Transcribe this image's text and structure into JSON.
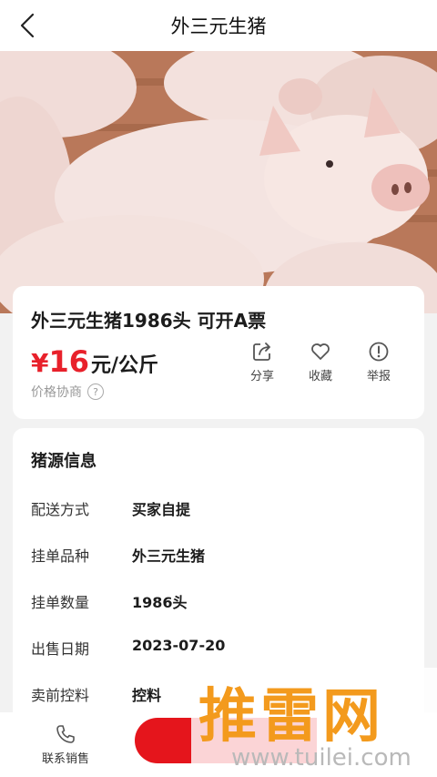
{
  "header": {
    "title": "外三元生猪",
    "back_icon": "chevron-left-icon"
  },
  "product": {
    "title": "外三元生猪1986头 可开A票",
    "price_currency": "¥",
    "price_value": "16",
    "price_unit": "元/公斤",
    "negotiable": "价格协商",
    "price_color": "#e8212b"
  },
  "actions": [
    {
      "label": "分享",
      "icon": "share-icon"
    },
    {
      "label": "收藏",
      "icon": "heart-icon"
    },
    {
      "label": "举报",
      "icon": "alert-icon"
    }
  ],
  "info": {
    "title": "猪源信息",
    "rows": [
      {
        "key": "配送方式",
        "value": "买家自提"
      },
      {
        "key": "挂单品种",
        "value": "外三元生猪"
      },
      {
        "key": "挂单数量",
        "value": "1986头"
      },
      {
        "key": "出售日期",
        "value": "2023-07-20"
      },
      {
        "key": "卖前控料",
        "value": "控料"
      }
    ]
  },
  "bottom": {
    "contact_label": "联系销售",
    "contact_icon": "phone-icon",
    "buy_color": "#e5151c"
  },
  "watermark": {
    "text": "推雷网",
    "url": "www.tuilei.com"
  }
}
